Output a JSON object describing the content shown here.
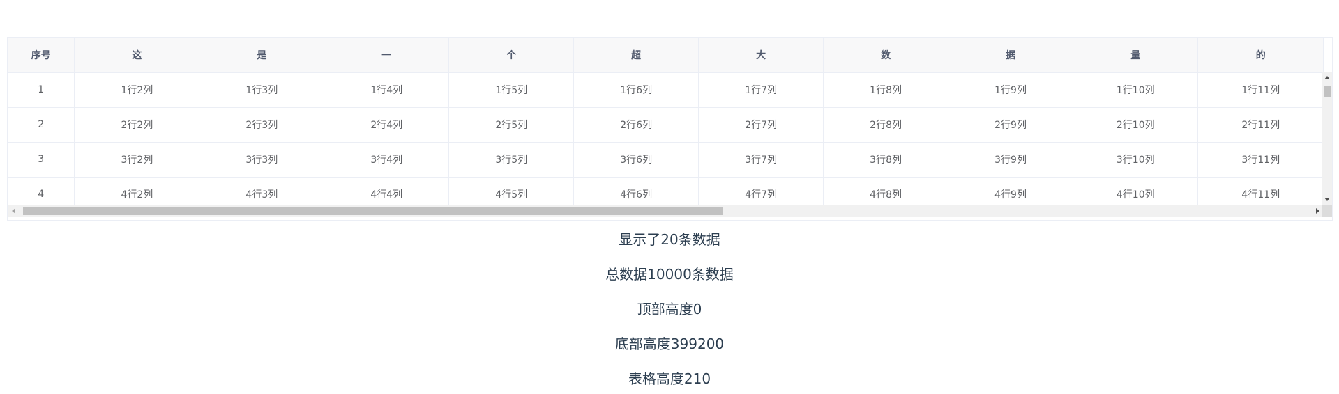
{
  "table": {
    "headers": [
      "序号",
      "这",
      "是",
      "一",
      "个",
      "超",
      "大",
      "数",
      "据",
      "量",
      "的"
    ],
    "rows": [
      [
        "1",
        "1行2列",
        "1行3列",
        "1行4列",
        "1行5列",
        "1行6列",
        "1行7列",
        "1行8列",
        "1行9列",
        "1行10列",
        "1行11列"
      ],
      [
        "2",
        "2行2列",
        "2行3列",
        "2行4列",
        "2行5列",
        "2行6列",
        "2行7列",
        "2行8列",
        "2行9列",
        "2行10列",
        "2行11列"
      ],
      [
        "3",
        "3行2列",
        "3行3列",
        "3行4列",
        "3行5列",
        "3行6列",
        "3行7列",
        "3行8列",
        "3行9列",
        "3行10列",
        "3行11列"
      ],
      [
        "4",
        "4行2列",
        "4行3列",
        "4行4列",
        "4行5列",
        "4行6列",
        "4行7列",
        "4行8列",
        "4行9列",
        "4行10列",
        "4行11列"
      ]
    ]
  },
  "scrollbars": {
    "vertical_icon_up": "arrow-up-icon",
    "vertical_icon_down": "arrow-down-icon",
    "horizontal_icon_left": "arrow-left-icon",
    "horizontal_icon_right": "arrow-right-icon"
  },
  "info": {
    "shown": "显示了20条数据",
    "total": "总数据10000条数据",
    "top_height": "顶部高度0",
    "bottom_height": "底部高度399200",
    "table_height": "表格高度210"
  }
}
